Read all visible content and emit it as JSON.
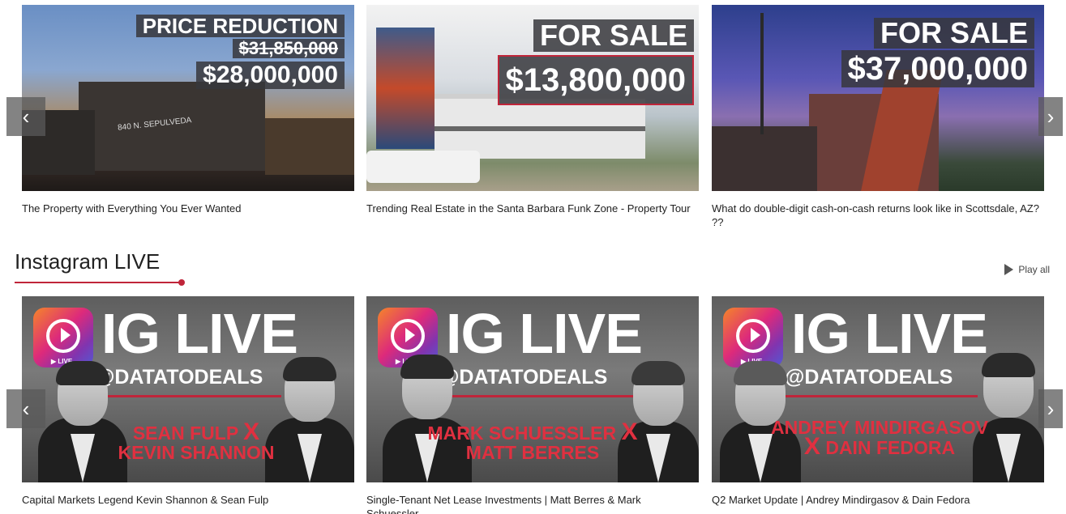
{
  "properties": [
    {
      "badge": "PRICE REDUCTION",
      "old_price": "$31,850,000",
      "price": "$28,000,000",
      "sign_text": "840 N. SEPULVEDA",
      "caption": "The Property with Everything You Ever Wanted"
    },
    {
      "badge": "FOR SALE",
      "price": "$13,800,000",
      "caption": "Trending Real Estate in the Santa Barbara Funk Zone - Property Tour"
    },
    {
      "badge": "FOR SALE",
      "price": "$37,000,000",
      "caption": "What do double-digit cash-on-cash returns look like in Scottsdale, AZ? ??"
    }
  ],
  "instagram": {
    "heading": "Instagram LIVE",
    "play_all": "Play all",
    "videos": [
      {
        "title": "IG LIVE",
        "live_tag": "▶ LIVE",
        "handle": "@DATATODEALS",
        "name_line1": "SEAN FULP",
        "x": "X",
        "name_line2": "KEVIN SHANNON",
        "caption": "Capital Markets Legend Kevin Shannon & Sean Fulp"
      },
      {
        "title": "IG LIVE",
        "live_tag": "▶ LIVE",
        "handle": "@DATATODEALS",
        "name_line1": "MARK SCHUESSLER",
        "x": "X",
        "name_line2": "MATT BERRES",
        "caption": "Single-Tenant Net Lease Investments | Matt Berres & Mark Schuessler"
      },
      {
        "title": "IG LIVE",
        "live_tag": "▶ LIVE",
        "handle": "@DATATODEALS",
        "name_line1": "ANDREY MINDIRGASOV",
        "x": "X",
        "name_line2": "DAIN FEDORA",
        "caption": "Q2 Market Update | Andrey Mindirgasov & Dain Fedora"
      }
    ]
  },
  "nav": {
    "prev": "‹",
    "next": "›"
  },
  "colors": {
    "accent": "#c0253a",
    "overlay": "#37373c"
  }
}
